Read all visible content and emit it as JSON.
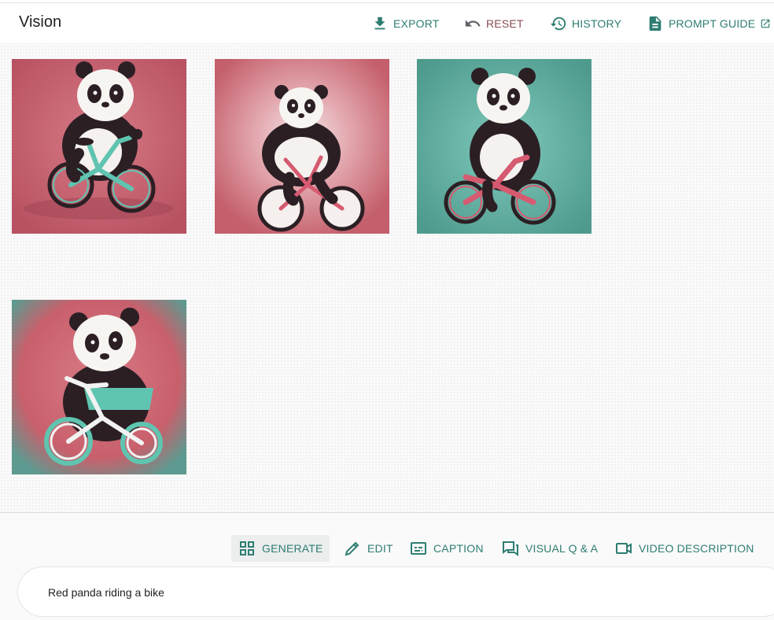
{
  "app": {
    "title": "Vision"
  },
  "header": {
    "actions": [
      {
        "label": "EXPORT",
        "icon": "download-icon"
      },
      {
        "label": "RESET",
        "icon": "undo-icon"
      },
      {
        "label": "HISTORY",
        "icon": "history-icon"
      },
      {
        "label": "PROMPT GUIDE",
        "icon": "document-icon",
        "trailing_icon": "open-in-new-icon"
      }
    ]
  },
  "gallery": {
    "images": [
      {
        "icon": "panda-on-bike-image",
        "background": "#c05a68",
        "bike_color": "#5fc4b0"
      },
      {
        "icon": "panda-on-bike-image",
        "background": "#c45f6c",
        "bike_color": "#d65a70"
      },
      {
        "icon": "panda-on-bike-image",
        "background": "#5aa89a",
        "bike_color": "#d65a70"
      },
      {
        "icon": "panda-on-bike-image",
        "background": "#c8606c",
        "bike_color": "#f2f2f2"
      }
    ]
  },
  "toolbar": {
    "modes": [
      {
        "label": "GENERATE",
        "icon": "grid-icon",
        "active": true
      },
      {
        "label": "EDIT",
        "icon": "pencil-icon",
        "active": false
      },
      {
        "label": "CAPTION",
        "icon": "caption-icon",
        "active": false
      },
      {
        "label": "VISUAL Q & A",
        "icon": "chat-icon",
        "active": false
      },
      {
        "label": "VIDEO DESCRIPTION",
        "icon": "video-icon",
        "active": false
      }
    ]
  },
  "prompt": {
    "value": "Red panda riding a bike"
  },
  "colors": {
    "accent": "#2e7d72",
    "reset_text": "#8a4d52",
    "gallery_bg": "#fafafa",
    "panel_bg": "#fafafa"
  }
}
